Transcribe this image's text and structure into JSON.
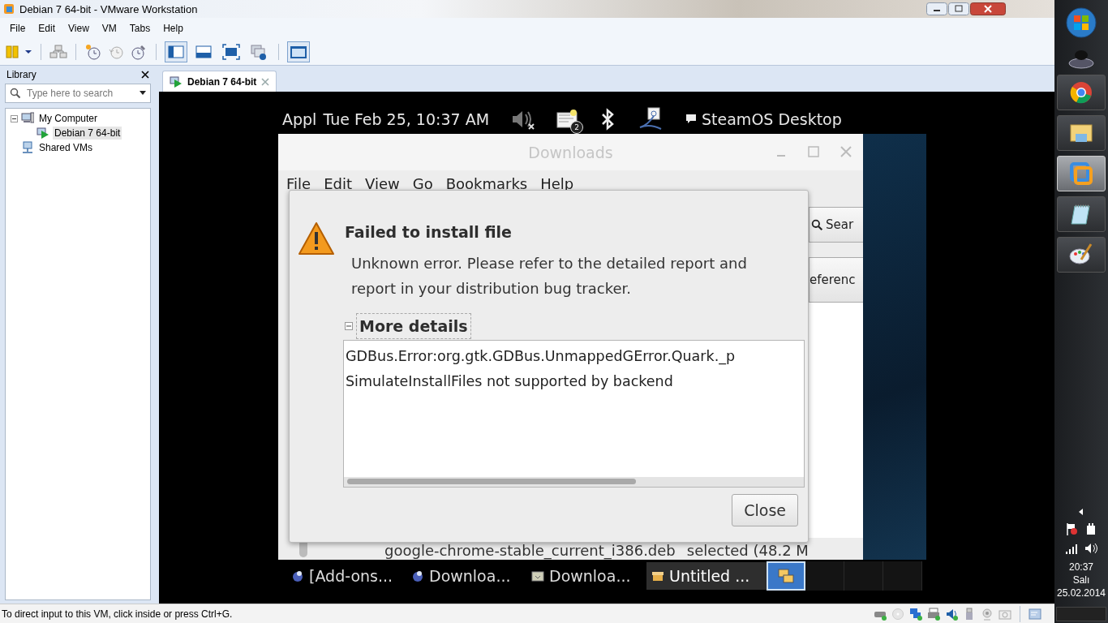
{
  "window": {
    "title": "Debian 7 64-bit - VMware Workstation"
  },
  "menu": [
    "File",
    "Edit",
    "View",
    "VM",
    "Tabs",
    "Help"
  ],
  "toolbar": {
    "view_buttons": [
      {
        "kind": "library",
        "selected": true
      },
      {
        "kind": "thumbnails",
        "selected": false
      },
      {
        "kind": "fullscreen",
        "selected": false
      },
      {
        "kind": "unity",
        "selected": false
      },
      {
        "kind": "console",
        "selected": true
      }
    ]
  },
  "library": {
    "title": "Library",
    "search": {
      "placeholder": "Type here to search"
    },
    "tree": [
      {
        "label": "My Computer",
        "kind": "computer",
        "selected": false,
        "expanded": true,
        "children": [
          {
            "label": "Debian 7 64-bit",
            "kind": "vm",
            "selected": true
          }
        ]
      },
      {
        "label": "Shared VMs",
        "kind": "shared",
        "selected": false
      }
    ]
  },
  "tabs": [
    {
      "label": "Debian 7 64-bit",
      "selected": true
    }
  ],
  "guest": {
    "top_bar": {
      "apps": "Appl",
      "clock": "Tue Feb 25, 10:37 AM",
      "mail_count": "2",
      "session": "SteamOS Desktop"
    },
    "file_manager": {
      "title": "Downloads",
      "menu": [
        "File",
        "Edit",
        "View",
        "Go",
        "Bookmarks",
        "Help"
      ],
      "search_button": "Sear",
      "preferences_button": "eferenc",
      "file_row": {
        "name": "google-chrome-stable_current_i386.deb",
        "status": "selected (48.2 M"
      }
    },
    "dialog": {
      "title": "Failed to install file",
      "message": "Unknown error. Please refer to the detailed report and report in your distribution bug tracker.",
      "details": {
        "label": "More details",
        "expanded": true,
        "lines": [
          "GDBus.Error:org.gtk.GDBus.UnmappedGError.Quark._p",
          "SimulateInstallFiles not supported by backend"
        ]
      },
      "button": "Close"
    },
    "taskbar": [
      {
        "label": "[Add-ons...",
        "kind": "browser",
        "selected": false
      },
      {
        "label": "Downloa...",
        "kind": "browser",
        "selected": false
      },
      {
        "label": "Downloa...",
        "kind": "folder",
        "selected": false
      },
      {
        "label": "Untitled ...",
        "kind": "package",
        "selected": true
      }
    ],
    "workspaces": [
      {
        "selected": true
      },
      {
        "selected": false
      },
      {
        "selected": false
      },
      {
        "selected": false
      }
    ]
  },
  "status_bar": {
    "text": "To direct input to this VM, click inside or press Ctrl+G."
  },
  "win_taskbar": {
    "pinned": [
      {
        "kind": "browser",
        "selected": false
      },
      {
        "kind": "folder",
        "selected": false
      },
      {
        "kind": "vm",
        "selected": true
      },
      {
        "kind": "notepad",
        "selected": false
      },
      {
        "kind": "palette",
        "selected": false
      }
    ],
    "time": "20:37",
    "day": "Salı",
    "date": "25.02.2014"
  }
}
